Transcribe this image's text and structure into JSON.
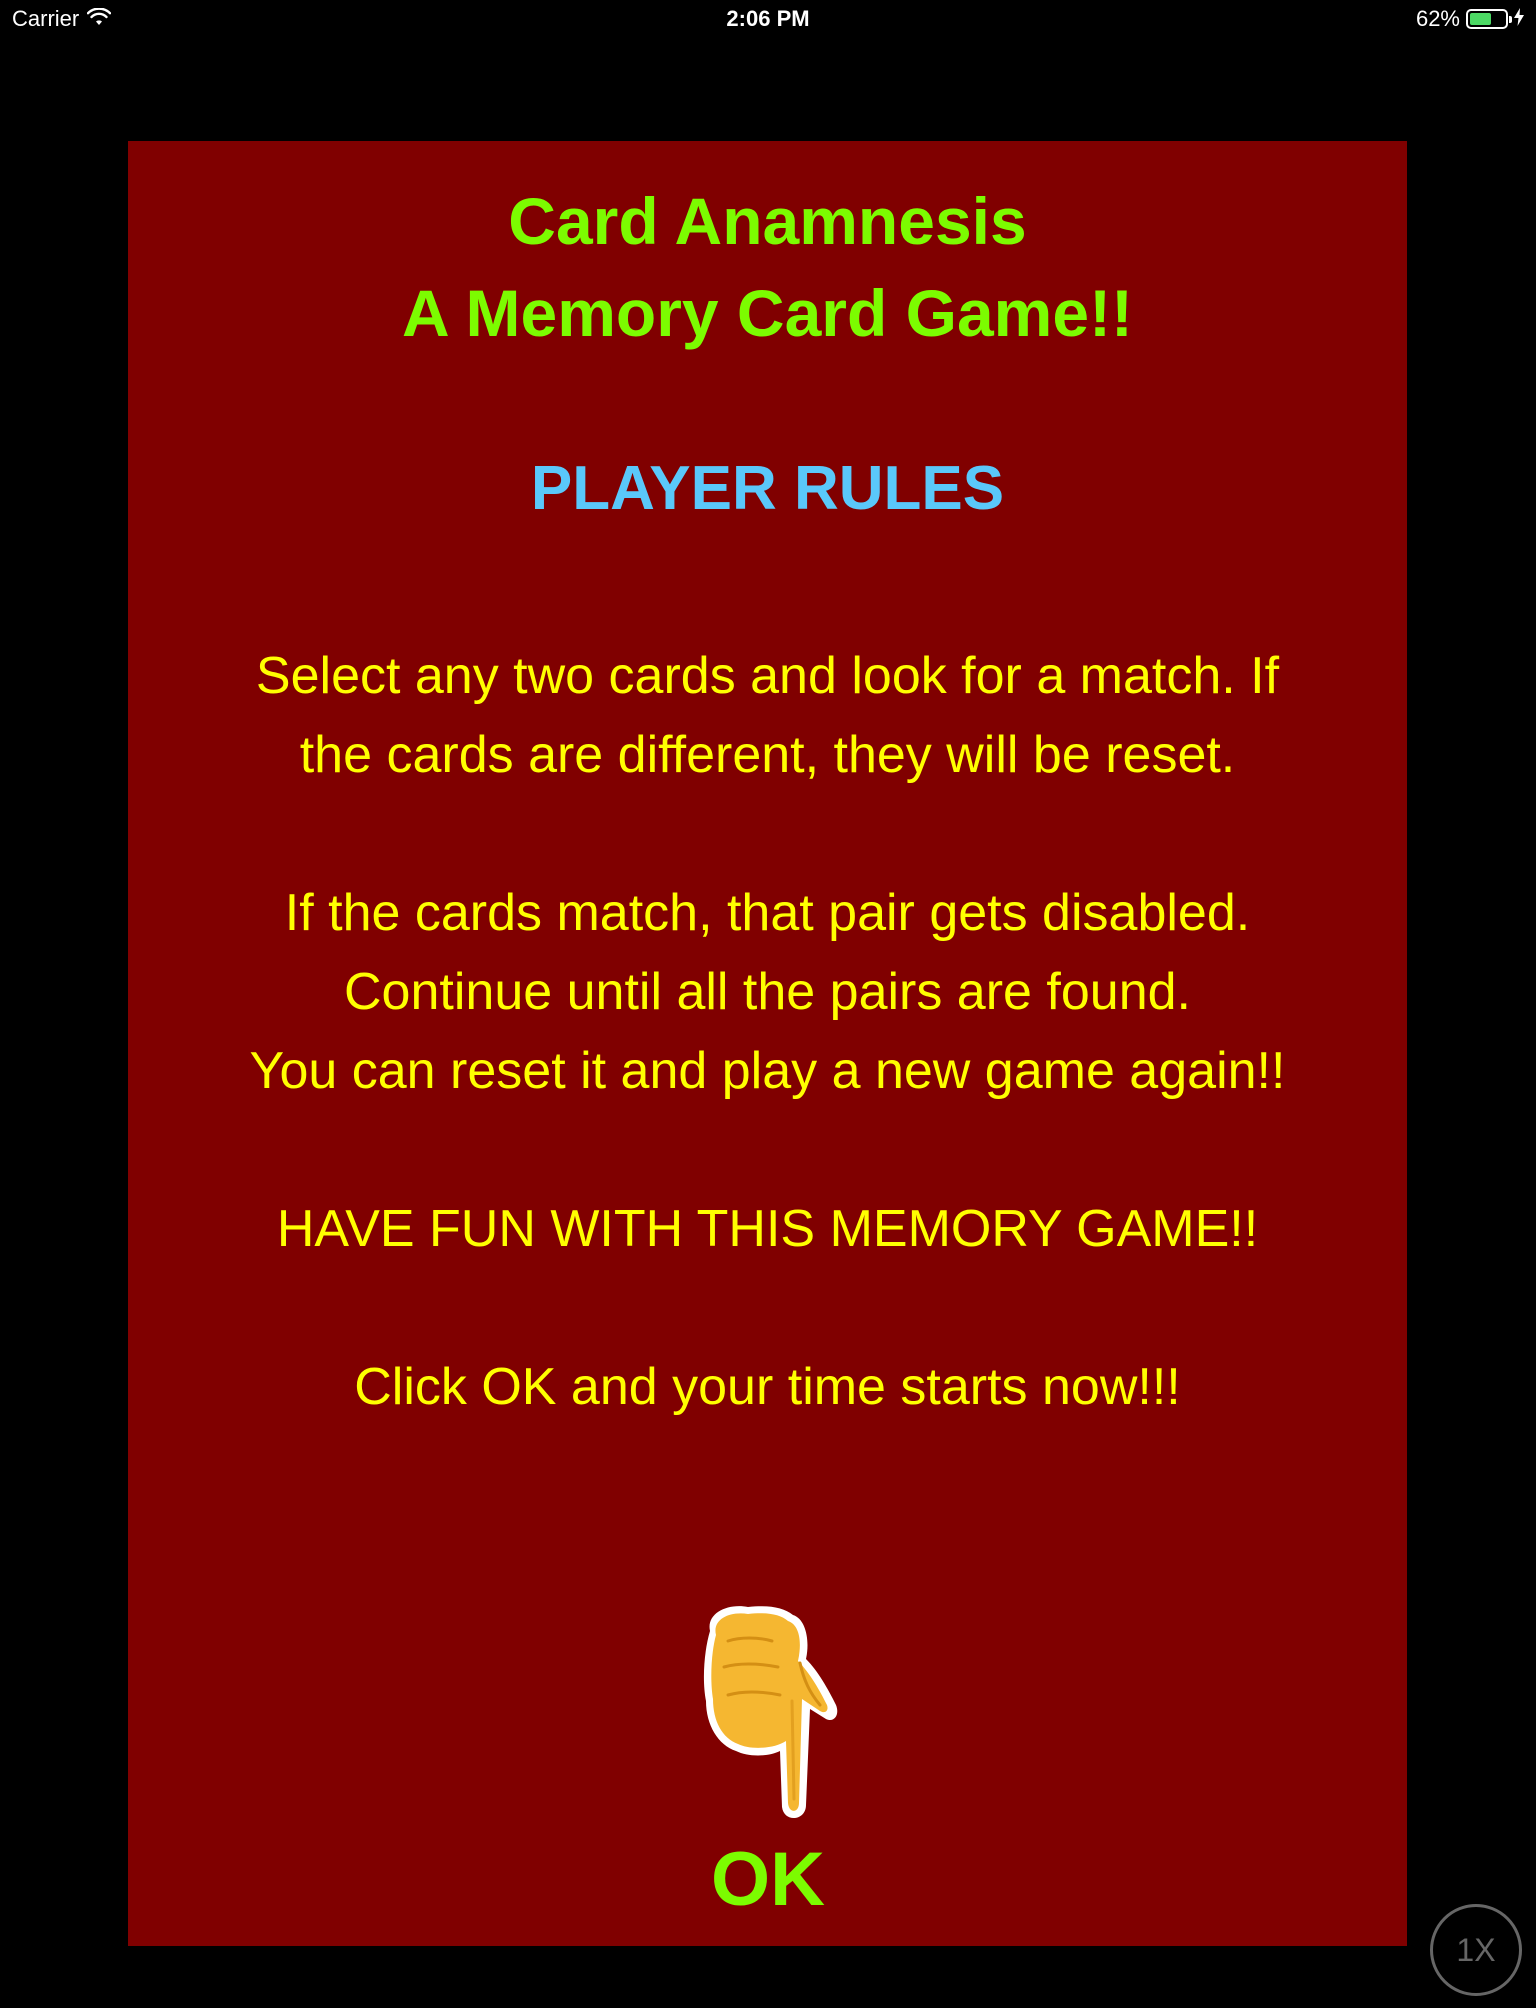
{
  "status_bar": {
    "carrier": "Carrier",
    "time": "2:06 PM",
    "battery_percent": "62%",
    "battery_level": 0.62
  },
  "panel": {
    "title_line1": "Card Anamnesis",
    "title_line2": "A Memory Card Game!!",
    "rules_heading": "PLAYER RULES",
    "rules_paragraph1_line1": "Select any two cards and look for a match. If",
    "rules_paragraph1_line2": "the cards are different, they will be reset.",
    "rules_paragraph2_line1": "If the cards match, that pair gets disabled.",
    "rules_paragraph2_line2": "Continue until all the pairs are found.",
    "rules_paragraph2_line3": "You can reset it and play a new game again!!",
    "rules_fun": "HAVE FUN WITH THIS MEMORY GAME!!",
    "rules_start": "Click OK and your time starts now!!!",
    "ok_label": "OK",
    "ok_icon": "pointing-down-hand-icon"
  },
  "zoom_badge": "1X",
  "colors": {
    "background": "#000000",
    "panel": "#800000",
    "title": "#7cfc00",
    "heading": "#5ac8fa",
    "body_text": "#ffff00",
    "ok": "#7cfc00"
  }
}
